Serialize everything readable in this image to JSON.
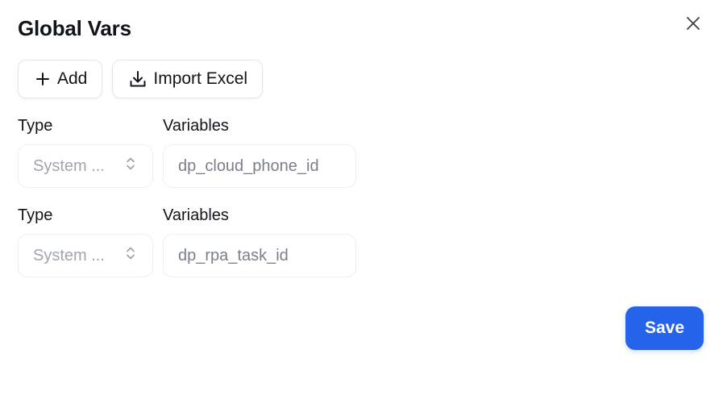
{
  "dialog": {
    "title": "Global Vars",
    "close_icon": "close-icon"
  },
  "toolbar": {
    "add_label": "Add",
    "add_icon": "plus-icon",
    "import_label": "Import Excel",
    "import_icon": "download-icon"
  },
  "rows": [
    {
      "type_label": "Type",
      "variables_label": "Variables",
      "type_value": "System ...",
      "type_icon": "chevron-up-down-icon",
      "variable_value": "dp_cloud_phone_id"
    },
    {
      "type_label": "Type",
      "variables_label": "Variables",
      "type_value": "System ...",
      "type_icon": "chevron-up-down-icon",
      "variable_value": "dp_rpa_task_id"
    }
  ],
  "footer": {
    "save_label": "Save"
  },
  "colors": {
    "primary": "#2563eb",
    "border": "#e3e6ea",
    "muted_text": "#a0a6ae"
  }
}
